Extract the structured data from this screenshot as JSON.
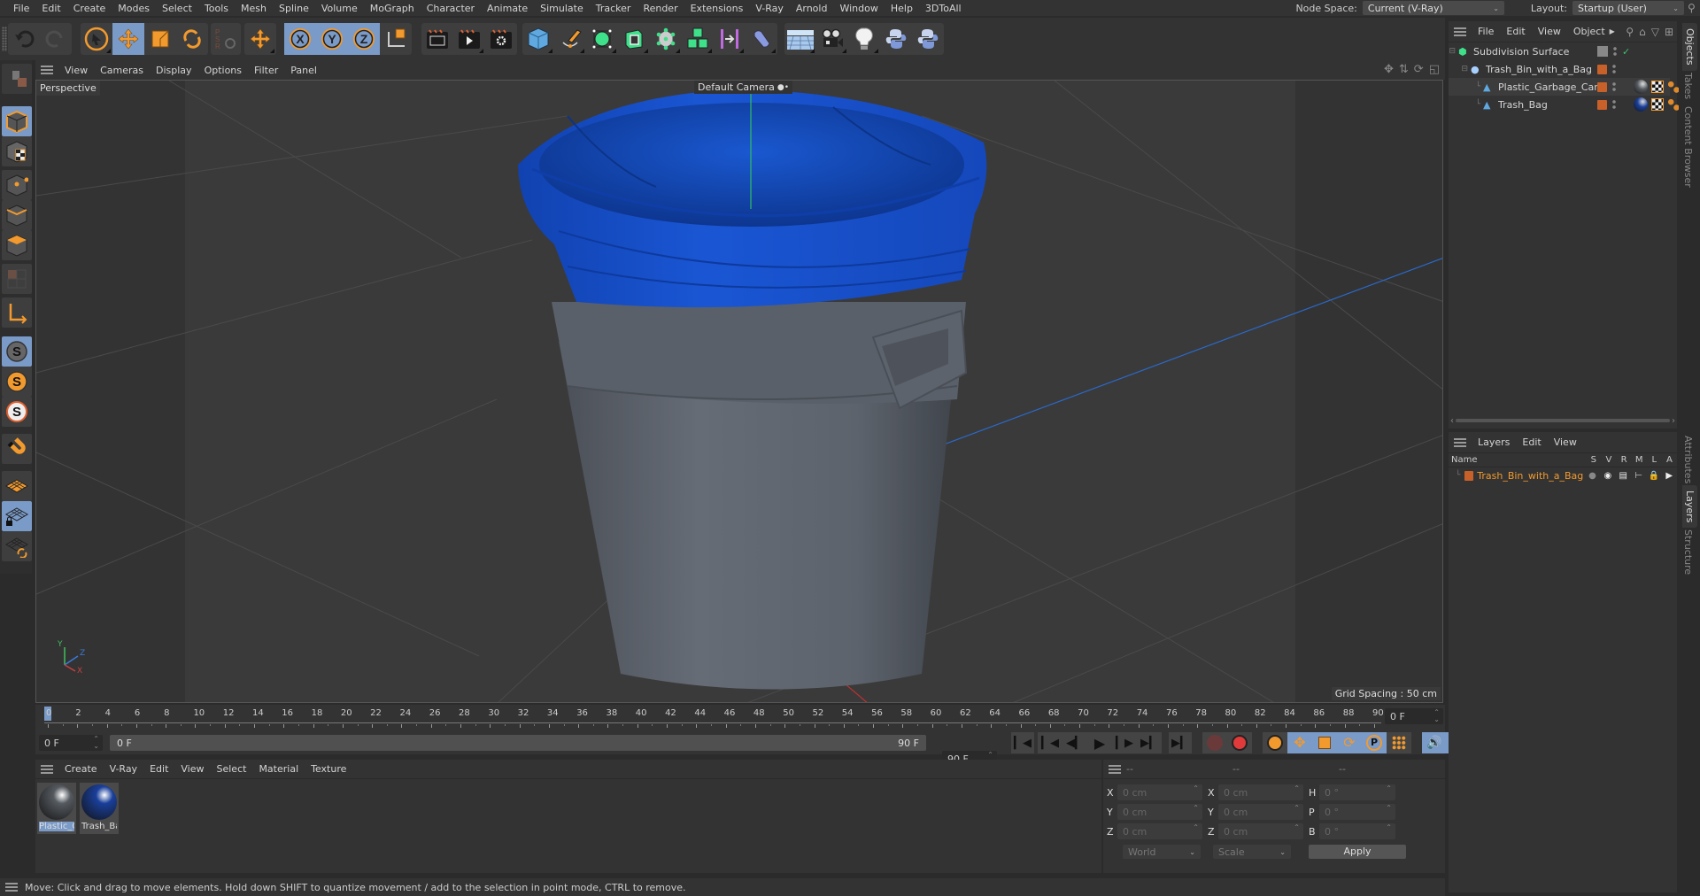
{
  "menubar": {
    "items": [
      "File",
      "Edit",
      "Create",
      "Modes",
      "Select",
      "Tools",
      "Mesh",
      "Spline",
      "Volume",
      "MoGraph",
      "Character",
      "Animate",
      "Simulate",
      "Tracker",
      "Render",
      "Extensions",
      "V-Ray",
      "Arnold",
      "Window",
      "Help",
      "3DToAll"
    ],
    "node_space_label": "Node Space:",
    "node_space_value": "Current (V-Ray)",
    "layout_label": "Layout:",
    "layout_value": "Startup (User)"
  },
  "toolbar": {
    "icons": [
      "undo-icon",
      "redo-icon",
      "select-cursor-icon",
      "move-icon",
      "scale-icon",
      "rotate-icon",
      "psr-icon",
      "transform-icon",
      "x-axis-icon",
      "y-axis-icon",
      "z-axis-icon",
      "coordinate-system-icon",
      "render-region-icon",
      "render-view-icon",
      "render-settings-icon",
      "cube-icon",
      "pen-icon",
      "subdivision-icon",
      "extrude-icon",
      "mograph-cloner-icon",
      "cloner-icon",
      "deformer-icon",
      "bend-icon",
      "floor-icon",
      "camera-icon",
      "light-icon",
      "python-icon",
      "python2-icon"
    ],
    "active": [
      "move-icon",
      "x-axis-icon",
      "y-axis-icon",
      "z-axis-icon"
    ]
  },
  "left_tools": {
    "icons": [
      "model-mode-icon",
      "texture-mode-icon",
      "point-mode-icon",
      "edge-mode-icon",
      "polygon-mode-icon",
      "uv-mode-icon",
      "axis-mode-icon",
      "snap-icon",
      "snap-settings-icon",
      "snap-3d-icon",
      "magnet-icon",
      "workplane-icon",
      "locked-workplane-icon",
      "workplane-align-icon"
    ]
  },
  "viewport": {
    "menu": [
      "View",
      "Cameras",
      "Display",
      "Options",
      "Filter",
      "Panel"
    ],
    "label": "Perspective",
    "camera": "Default Camera",
    "grid_spacing": "Grid Spacing : 50 cm",
    "axes": {
      "x": "X",
      "y": "Y",
      "z": "Z"
    },
    "colors": {
      "bag": "#1650c8",
      "can": "#5e646e",
      "bg": "#3a3a3a"
    }
  },
  "timeline": {
    "ticks": [
      "0",
      "2",
      "4",
      "6",
      "8",
      "10",
      "12",
      "14",
      "16",
      "18",
      "20",
      "22",
      "24",
      "26",
      "28",
      "30",
      "32",
      "34",
      "36",
      "38",
      "40",
      "42",
      "44",
      "46",
      "48",
      "50",
      "52",
      "54",
      "56",
      "58",
      "60",
      "62",
      "64",
      "66",
      "68",
      "70",
      "72",
      "74",
      "76",
      "78",
      "80",
      "82",
      "84",
      "86",
      "88",
      "90"
    ],
    "current_frame": "0 F",
    "start": "0 F",
    "range_start": "0 F",
    "range_end": "90 F",
    "end": "90 F"
  },
  "materials": {
    "menu": [
      "Create",
      "V-Ray",
      "Edit",
      "View",
      "Select",
      "Material",
      "Texture"
    ],
    "items": [
      {
        "label": "Plastic_G",
        "color": "#555a60",
        "selected": true
      },
      {
        "label": "Trash_Ba",
        "color": "#1a3f9a",
        "selected": false
      }
    ]
  },
  "coords": {
    "headers": [
      "--",
      "--",
      "--"
    ],
    "rows": [
      {
        "a": "X",
        "av": "0 cm",
        "b": "X",
        "bv": "0 cm",
        "c": "H",
        "cv": "0 °"
      },
      {
        "a": "Y",
        "av": "0 cm",
        "b": "Y",
        "bv": "0 cm",
        "c": "P",
        "cv": "0 °"
      },
      {
        "a": "Z",
        "av": "0 cm",
        "b": "Z",
        "bv": "0 cm",
        "c": "B",
        "cv": "0 °"
      }
    ],
    "space": "World",
    "mode": "Scale",
    "apply": "Apply"
  },
  "objects": {
    "menu": [
      "File",
      "Edit",
      "View",
      "Object"
    ],
    "tree": [
      {
        "name": "Subdivision Surface",
        "indent": 0
      },
      {
        "name": "Trash_Bin_with_a_Bag",
        "indent": 1
      },
      {
        "name": "Plastic_Garbage_Can",
        "indent": 2
      },
      {
        "name": "Trash_Bag",
        "indent": 2
      }
    ]
  },
  "layers": {
    "menu": [
      "Layers",
      "Edit",
      "View"
    ],
    "columns": [
      "Name",
      "S",
      "V",
      "R",
      "M",
      "L",
      "A"
    ],
    "rows": [
      {
        "name": "Trash_Bin_with_a_Bag",
        "color": "#c8602a"
      }
    ]
  },
  "side_tabs": [
    "Objects",
    "Takes",
    "Content Browser",
    "Attributes",
    "Layers",
    "Structure"
  ],
  "status": "Move: Click and drag to move elements. Hold down SHIFT to quantize movement / add to the selection in point mode, CTRL to remove."
}
